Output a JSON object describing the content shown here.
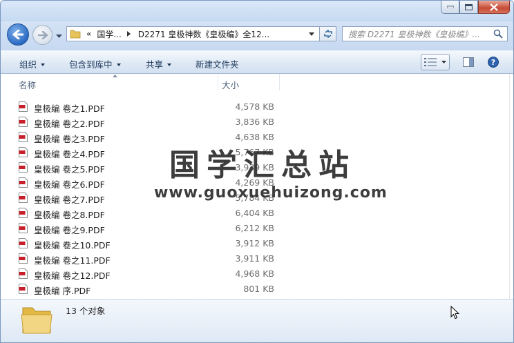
{
  "window": {
    "controls": {
      "minimize": "minimize",
      "maximize": "maximize",
      "close": "close"
    }
  },
  "navigation": {
    "back_icon": "back-arrow-icon",
    "forward_icon": "forward-arrow-icon",
    "address": {
      "overflow": "«",
      "crumb1": "国学...",
      "crumb2": "D2271 皇极神数《皇极编》全12..."
    },
    "search": {
      "placeholder": "搜索 D2271 皇极神数《皇极编》..."
    }
  },
  "toolbar": {
    "organize": "组织",
    "include_in_library": "包含到库中",
    "share": "共享",
    "new_folder": "新建文件夹"
  },
  "columns": {
    "name": "名称",
    "size": "大小"
  },
  "files": [
    {
      "name": "皇极编 卷之1.PDF",
      "size": "4,578 KB"
    },
    {
      "name": "皇极编 卷之2.PDF",
      "size": "3,836 KB"
    },
    {
      "name": "皇极编 卷之3.PDF",
      "size": "4,638 KB"
    },
    {
      "name": "皇极编 卷之4.PDF",
      "size": "5,767 KB"
    },
    {
      "name": "皇极编 卷之5.PDF",
      "size": "3,939 KB"
    },
    {
      "name": "皇极编 卷之6.PDF",
      "size": "4,269 KB"
    },
    {
      "name": "皇极编 卷之7.PDF",
      "size": "5,784 KB"
    },
    {
      "name": "皇极编 卷之8.PDF",
      "size": "6,404 KB"
    },
    {
      "name": "皇极编 卷之9.PDF",
      "size": "6,212 KB"
    },
    {
      "name": "皇极编 卷之10.PDF",
      "size": "3,912 KB"
    },
    {
      "name": "皇极编 卷之11.PDF",
      "size": "3,911 KB"
    },
    {
      "name": "皇极编 卷之12.PDF",
      "size": "4,968 KB"
    },
    {
      "name": "皇极编 序.PDF",
      "size": "801 KB"
    }
  ],
  "details": {
    "count": "13 个对象"
  },
  "watermark": {
    "title": "国学汇总站",
    "url": "www.guoxuehuizong.com"
  },
  "colors": {
    "accent": "#2a6bc4",
    "toolbar_text": "#1e395b",
    "pdf_icon": "#c8202a"
  }
}
